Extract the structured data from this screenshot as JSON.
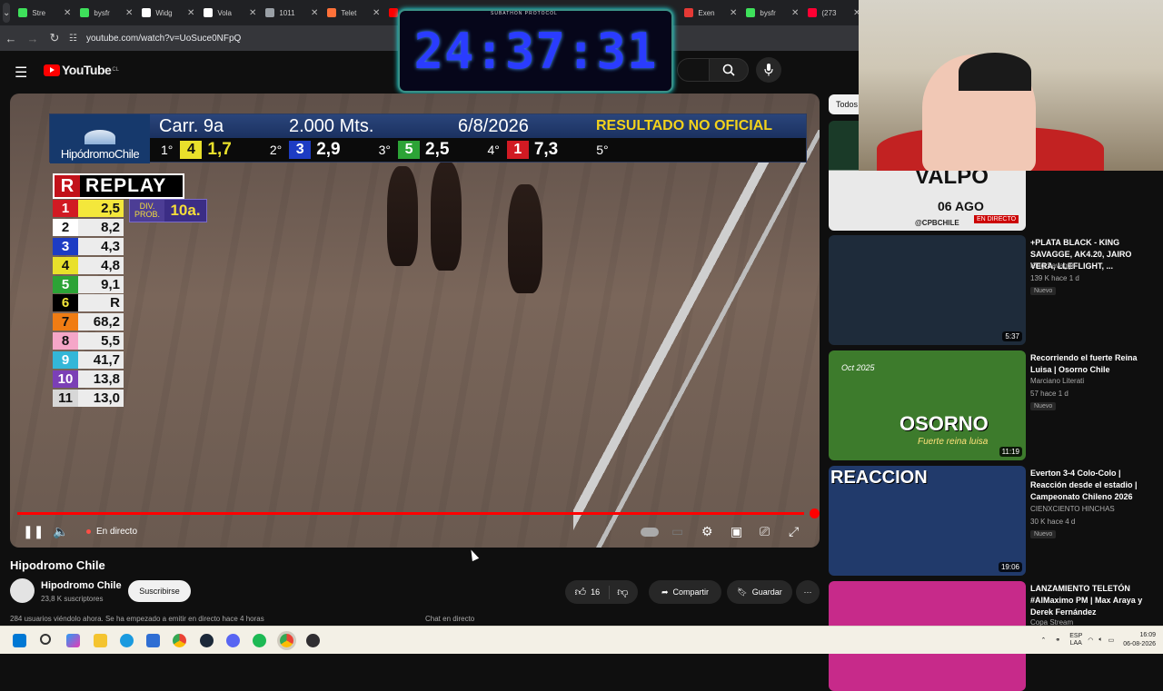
{
  "browser": {
    "tabs": [
      {
        "label": "Stre",
        "color": "#3ee15b"
      },
      {
        "label": "bysfr",
        "color": "#3ee15b"
      },
      {
        "label": "Widg",
        "color": "#ffffff"
      },
      {
        "label": "Vola",
        "color": "#ffffff"
      },
      {
        "label": "1011",
        "color": "#9aa0a6"
      },
      {
        "label": "Telet",
        "color": "#ff7139"
      },
      {
        "label": "",
        "color": "#ff0000"
      },
      {
        "label": "Exen",
        "color": "#e53935"
      },
      {
        "label": "bysfr",
        "color": "#3ee15b"
      },
      {
        "label": "(273",
        "color": "#ff0033"
      }
    ],
    "url": "youtube.com/watch?v=UoSuce0NFpQ"
  },
  "youtube": {
    "logo": "YouTube",
    "country": "CL"
  },
  "overlay_timer": {
    "title": "SUBATHON PROTOCOL",
    "time": "24:37:31"
  },
  "race": {
    "carrera": "Carr. 9a",
    "distance": "2.000 Mts.",
    "date": "6/8/2026",
    "status": "RESULTADO NO OFICIAL",
    "logo": "HipódromoChile",
    "placings": [
      {
        "pos": "1°",
        "num": "4",
        "val": "1,7",
        "bg": "#e9e02b",
        "fg": "#111111"
      },
      {
        "pos": "2°",
        "num": "3",
        "val": "2,9",
        "bg": "#1d3cc4",
        "fg": "#ffffff"
      },
      {
        "pos": "3°",
        "num": "5",
        "val": "2,5",
        "bg": "#2ca336",
        "fg": "#ffffff"
      },
      {
        "pos": "4°",
        "num": "1",
        "val": "7,3",
        "bg": "#d11a23",
        "fg": "#ffffff"
      },
      {
        "pos": "5°",
        "num": "",
        "val": "",
        "bg": "#000000",
        "fg": "#ffffff"
      }
    ],
    "replay_letter": "R",
    "replay_label": "REPLAY",
    "div_prob_label": "DIV. PROB.",
    "div_prob_value": "10a.",
    "odds": [
      {
        "n": "1",
        "v": "2,5",
        "bg": "#d11a23",
        "fg": "#ffffff",
        "vbg": "#f4e73b"
      },
      {
        "n": "2",
        "v": "8,2",
        "bg": "#ffffff",
        "fg": "#111111",
        "vbg": "#ececec"
      },
      {
        "n": "3",
        "v": "4,3",
        "bg": "#1d3cc4",
        "fg": "#ffffff",
        "vbg": "#ececec"
      },
      {
        "n": "4",
        "v": "4,8",
        "bg": "#e9e02b",
        "fg": "#111111",
        "vbg": "#ececec"
      },
      {
        "n": "5",
        "v": "9,1",
        "bg": "#2ca336",
        "fg": "#ffffff",
        "vbg": "#ececec"
      },
      {
        "n": "6",
        "v": "R",
        "bg": "#000000",
        "fg": "#f4e73b",
        "vbg": "#ececec"
      },
      {
        "n": "7",
        "v": "68,2",
        "bg": "#f07c13",
        "fg": "#111111",
        "vbg": "#ececec"
      },
      {
        "n": "8",
        "v": "5,5",
        "bg": "#f5a6c8",
        "fg": "#111111",
        "vbg": "#ececec"
      },
      {
        "n": "9",
        "v": "41,7",
        "bg": "#33b7d8",
        "fg": "#ffffff",
        "vbg": "#ececec"
      },
      {
        "n": "10",
        "v": "13,8",
        "bg": "#7b3fb6",
        "fg": "#ffffff",
        "vbg": "#ececec"
      },
      {
        "n": "11",
        "v": "13,0",
        "bg": "#d7d7d7",
        "fg": "#111111",
        "vbg": "#ececec"
      }
    ]
  },
  "player": {
    "live_label": "En directo",
    "progress": 0.99
  },
  "video_info": {
    "title": "Hipodromo Chile",
    "channel": "Hipodromo Chile",
    "subscribers": "23,8 K suscriptores",
    "subscribe": "Suscribirse",
    "likes": "16",
    "share": "Compartir",
    "save": "Guardar",
    "viewers_line": "284 usuarios viéndolo ahora. Se ha empezado a emitir en directo hace 4 horas",
    "chat_label": "Chat en directo"
  },
  "sidebar": {
    "chip": "Todos",
    "top_thumb": {
      "text": "VALPO",
      "sub": "06 AGO",
      "live": "EN DIRECTO",
      "tag": "@CPBCHILE"
    },
    "recs": [
      {
        "title": "+PLATA BLACK - KING SAVAGGE, AK4.20, JAIRO VERA, LLEFLIGHT, ...",
        "channel": "King Savagge",
        "meta": "139 K  hace 1 d",
        "badge": "Nuevo",
        "duration": "5:37",
        "thumb_text": "",
        "thumb_color": "#1e2b3a"
      },
      {
        "title": "Recorriendo el fuerte Reina Luisa | Osorno Chile",
        "channel": "Marciano Literati",
        "meta": "57  hace 1 d",
        "badge": "Nuevo",
        "duration": "11:19",
        "thumb_text": "OSORNO",
        "thumb_sub": "Fuerte reina luisa",
        "thumb_tag": "Oct 2025",
        "thumb_color": "#3d7b2c"
      },
      {
        "title": "Everton 3-4 Colo-Colo | Reacción desde el estadio | Campeonato Chileno 2026",
        "channel": "CIENXCIENTO HINCHAS",
        "meta": "30 K  hace 4 d",
        "badge": "Nuevo",
        "duration": "19:06",
        "thumb_text": "REACCION",
        "thumb_color": "#213a6b"
      },
      {
        "title": "LANZAMIENTO TELETÓN #AlMaximo PM | Max Araya y Derek Fernández",
        "channel": "Copa Stream",
        "meta": "",
        "badge": "",
        "duration": "",
        "thumb_text": "",
        "thumb_color": "#c72a8a"
      }
    ]
  },
  "taskbar": {
    "lang": "ESP\nLAA",
    "time": "16:09",
    "date": "06-08-2026"
  }
}
